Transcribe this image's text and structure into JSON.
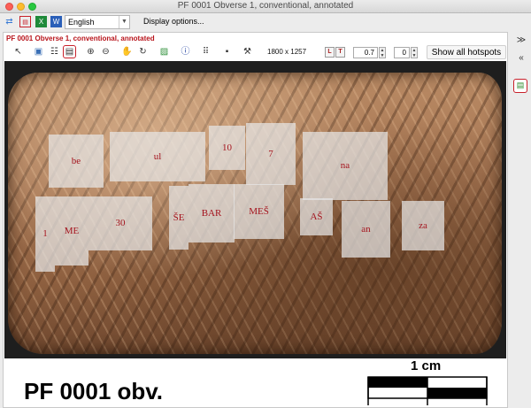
{
  "window": {
    "title": "PF 0001 Obverse 1, conventional, annotated"
  },
  "toolbar": {
    "language": "English",
    "display_options": "Display options..."
  },
  "panel": {
    "title": "PF 0001 Obverse 1, conventional, annotated",
    "dimensions": "1800 x 1257",
    "l_button": "L",
    "t_button": "T",
    "zoom_value": "0.7",
    "rotation_value": "0",
    "show_hotspots": "Show all hotspots"
  },
  "hotspots": [
    {
      "id": "be",
      "label": "be"
    },
    {
      "id": "ul",
      "label": "ul"
    },
    {
      "id": "10",
      "label": "10"
    },
    {
      "id": "7",
      "label": "7"
    },
    {
      "id": "na",
      "label": "na"
    },
    {
      "id": "1",
      "label": "1"
    },
    {
      "id": "me",
      "label": "ME"
    },
    {
      "id": "30",
      "label": "30"
    },
    {
      "id": "se",
      "label": "ŠE"
    },
    {
      "id": "bar",
      "label": "BAR"
    },
    {
      "id": "mes",
      "label": "MEŠ"
    },
    {
      "id": "as",
      "label": "AŠ"
    },
    {
      "id": "an",
      "label": "an"
    },
    {
      "id": "za",
      "label": "za"
    }
  ],
  "footer": {
    "tablet_label": "PF 0001 obv.",
    "scale_label": "1 cm"
  },
  "colors": {
    "accent_red": "#b8141b",
    "hotspot_text": "#a4141e"
  }
}
